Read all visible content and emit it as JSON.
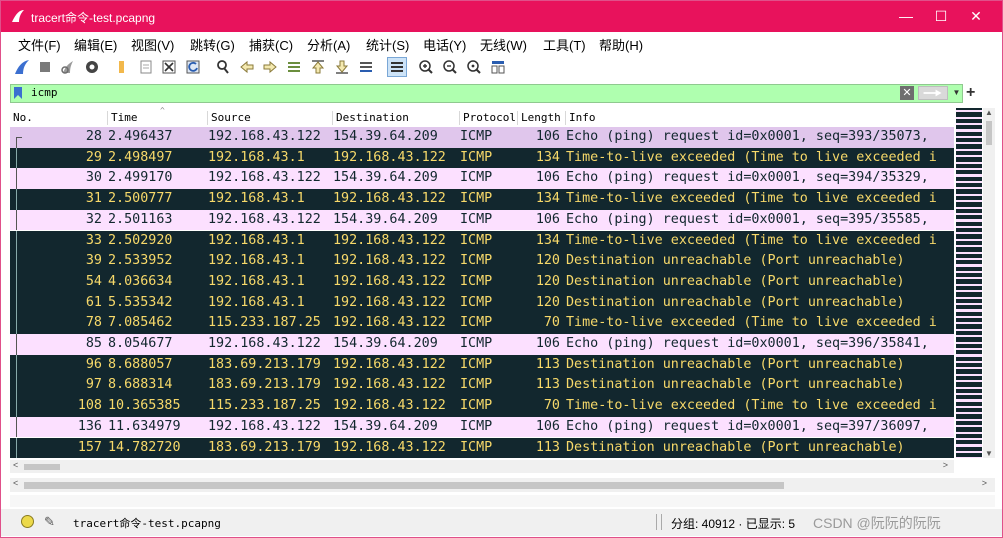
{
  "window": {
    "title": "tracert命令-test.pcapng",
    "controls": {
      "minimize": "—",
      "maximize": "☐",
      "close": "✕"
    }
  },
  "menu": [
    "文件(F)",
    "编辑(E)",
    "视图(V)",
    "跳转(G)",
    "捕获(C)",
    "分析(A)",
    "统计(S)",
    "电话(Y)",
    "无线(W)",
    "工具(T)",
    "帮助(H)"
  ],
  "toolbar_icons": [
    "shark-fin-start-icon",
    "stop-square-icon",
    "restart-icon",
    "options-gear-icon",
    "open-folder-icon",
    "save-file-icon",
    "close-file-icon",
    "reload-icon",
    "find-magnifier-icon",
    "go-back-icon",
    "go-forward-icon",
    "go-to-packet-icon",
    "go-first-icon",
    "go-last-icon",
    "auto-scroll-icon",
    "colorize-icon",
    "zoom-in-icon",
    "zoom-out-icon",
    "zoom-normal-icon",
    "resize-columns-icon"
  ],
  "filter": {
    "value": "icmp",
    "clear_label": "✕",
    "apply_label": "⇨",
    "add_label": "+"
  },
  "columns": [
    "No.",
    "Time",
    "Source",
    "Destination",
    "Protocol",
    "Length",
    "Info"
  ],
  "colors": {
    "title_bar": "#e8125c",
    "filter_ok": "#afffaf",
    "row_request_bg": "#fce0ff",
    "row_request_selected_bg": "#e0c6ec",
    "row_request_fg": "#12272e",
    "row_error_bg": "#12272e",
    "row_error_fg": "#f7d96a"
  },
  "packets": [
    {
      "no": "28",
      "time": "2.496437",
      "src": "192.168.43.122",
      "dst": "154.39.64.209",
      "proto": "ICMP",
      "len": "106",
      "info": "Echo (ping) request  id=0x0001, seq=393/35073,",
      "kind": "request",
      "selected": true
    },
    {
      "no": "29",
      "time": "2.498497",
      "src": "192.168.43.1",
      "dst": "192.168.43.122",
      "proto": "ICMP",
      "len": "134",
      "info": "Time-to-live exceeded (Time to live exceeded i",
      "kind": "error"
    },
    {
      "no": "30",
      "time": "2.499170",
      "src": "192.168.43.122",
      "dst": "154.39.64.209",
      "proto": "ICMP",
      "len": "106",
      "info": "Echo (ping) request  id=0x0001, seq=394/35329,",
      "kind": "request"
    },
    {
      "no": "31",
      "time": "2.500777",
      "src": "192.168.43.1",
      "dst": "192.168.43.122",
      "proto": "ICMP",
      "len": "134",
      "info": "Time-to-live exceeded (Time to live exceeded i",
      "kind": "error"
    },
    {
      "no": "32",
      "time": "2.501163",
      "src": "192.168.43.122",
      "dst": "154.39.64.209",
      "proto": "ICMP",
      "len": "106",
      "info": "Echo (ping) request  id=0x0001, seq=395/35585,",
      "kind": "request"
    },
    {
      "no": "33",
      "time": "2.502920",
      "src": "192.168.43.1",
      "dst": "192.168.43.122",
      "proto": "ICMP",
      "len": "134",
      "info": "Time-to-live exceeded (Time to live exceeded i",
      "kind": "error"
    },
    {
      "no": "39",
      "time": "2.533952",
      "src": "192.168.43.1",
      "dst": "192.168.43.122",
      "proto": "ICMP",
      "len": "120",
      "info": "Destination unreachable (Port unreachable)",
      "kind": "error"
    },
    {
      "no": "54",
      "time": "4.036634",
      "src": "192.168.43.1",
      "dst": "192.168.43.122",
      "proto": "ICMP",
      "len": "120",
      "info": "Destination unreachable (Port unreachable)",
      "kind": "error"
    },
    {
      "no": "61",
      "time": "5.535342",
      "src": "192.168.43.1",
      "dst": "192.168.43.122",
      "proto": "ICMP",
      "len": "120",
      "info": "Destination unreachable (Port unreachable)",
      "kind": "error"
    },
    {
      "no": "78",
      "time": "7.085462",
      "src": "115.233.187.25",
      "dst": "192.168.43.122",
      "proto": "ICMP",
      "len": "70",
      "info": "Time-to-live exceeded (Time to live exceeded i",
      "kind": "error"
    },
    {
      "no": "85",
      "time": "8.054677",
      "src": "192.168.43.122",
      "dst": "154.39.64.209",
      "proto": "ICMP",
      "len": "106",
      "info": "Echo (ping) request  id=0x0001, seq=396/35841,",
      "kind": "request"
    },
    {
      "no": "96",
      "time": "8.688057",
      "src": "183.69.213.179",
      "dst": "192.168.43.122",
      "proto": "ICMP",
      "len": "113",
      "info": "Destination unreachable (Port unreachable)",
      "kind": "error"
    },
    {
      "no": "97",
      "time": "8.688314",
      "src": "183.69.213.179",
      "dst": "192.168.43.122",
      "proto": "ICMP",
      "len": "113",
      "info": "Destination unreachable (Port unreachable)",
      "kind": "error"
    },
    {
      "no": "108",
      "time": "10.365385",
      "src": "115.233.187.25",
      "dst": "192.168.43.122",
      "proto": "ICMP",
      "len": "70",
      "info": "Time-to-live exceeded (Time to live exceeded i",
      "kind": "error"
    },
    {
      "no": "136",
      "time": "11.634979",
      "src": "192.168.43.122",
      "dst": "154.39.64.209",
      "proto": "ICMP",
      "len": "106",
      "info": "Echo (ping) request  id=0x0001, seq=397/36097,",
      "kind": "request"
    },
    {
      "no": "157",
      "time": "14.782720",
      "src": "183.69.213.179",
      "dst": "192.168.43.122",
      "proto": "ICMP",
      "len": "113",
      "info": "Destination unreachable (Port unreachable)",
      "kind": "error"
    }
  ],
  "statusbar": {
    "filename": "tracert命令-test.pcapng",
    "stats": "分组: 40912 · 已显示: 5",
    "watermark": "CSDN @阮阮的阮阮"
  }
}
